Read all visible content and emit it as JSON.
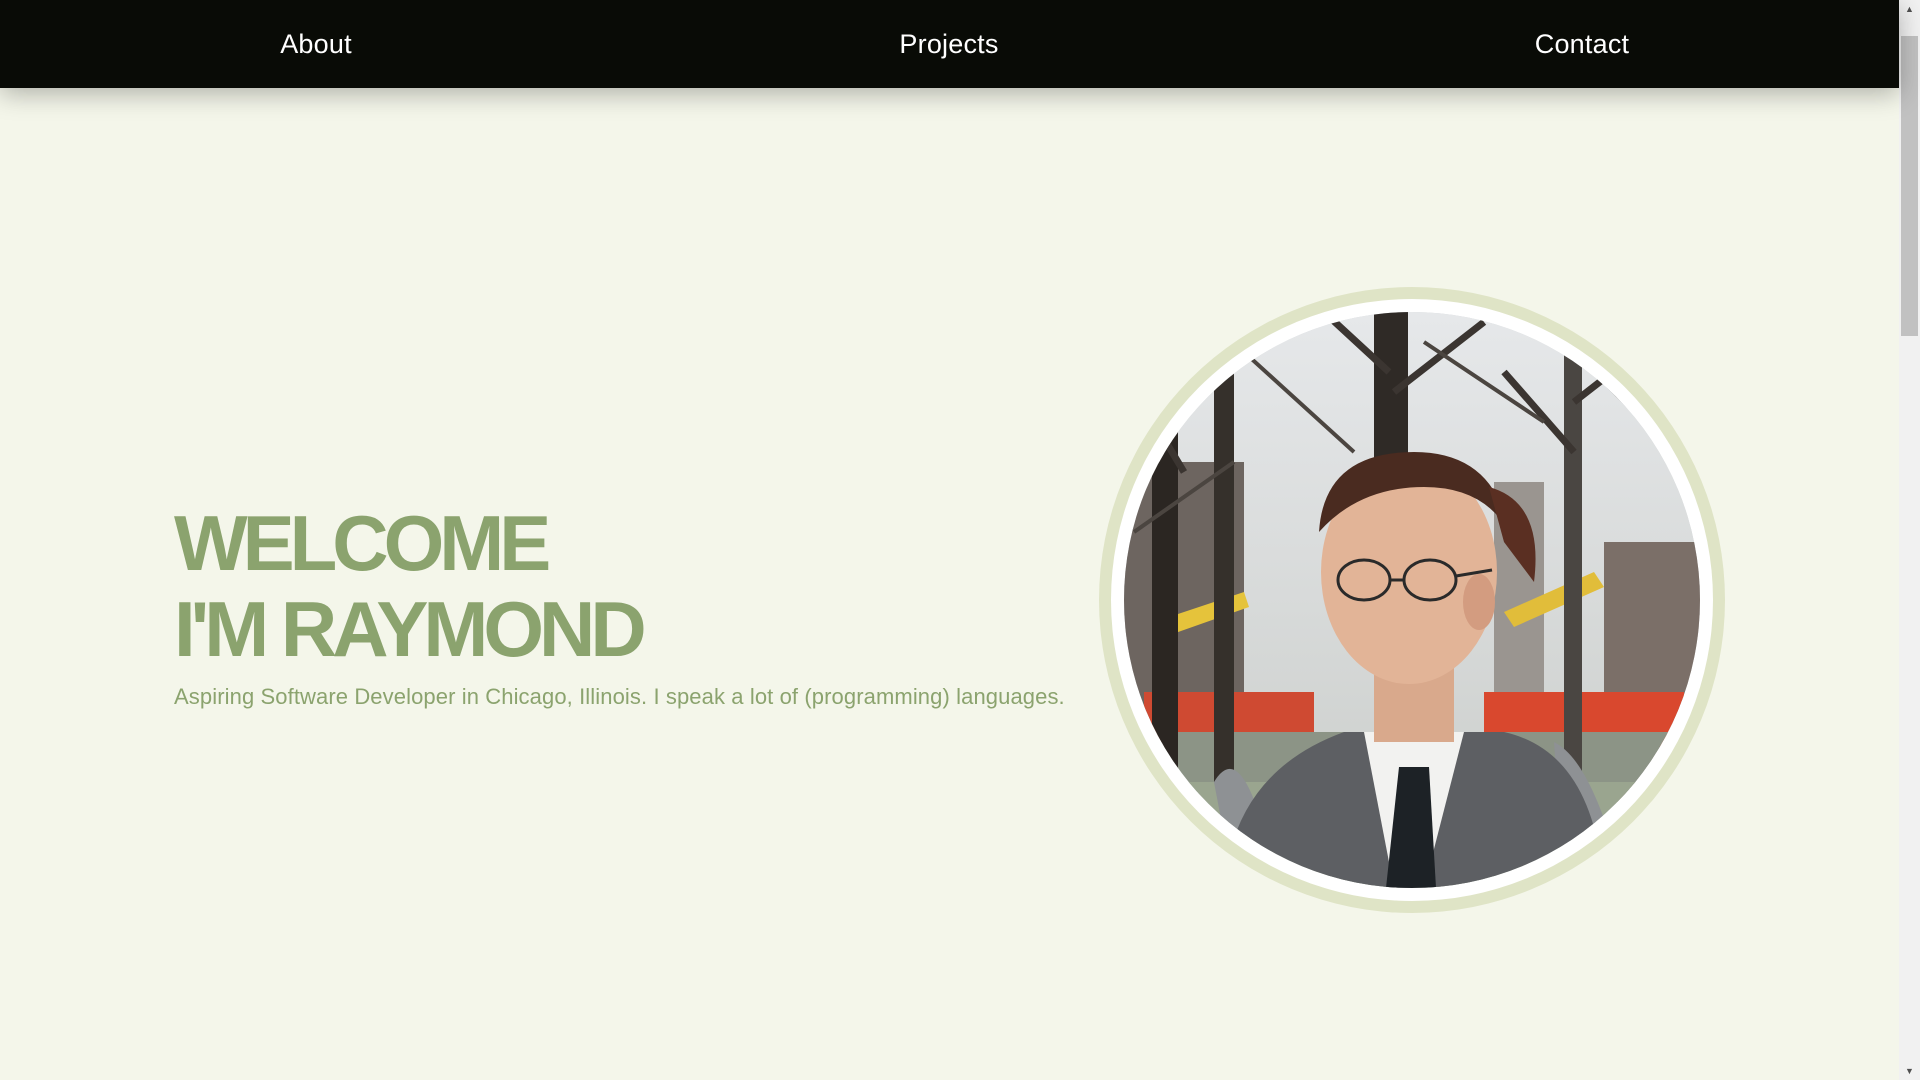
{
  "nav": {
    "about": "About",
    "projects": "Projects",
    "contact": "Contact"
  },
  "hero": {
    "line1": "WELCOME",
    "line2": "I'M RAYMOND",
    "subtitle": "Aspiring Software Developer in Chicago, Illinois. I speak a lot of (programming) languages."
  },
  "colors": {
    "nav_background": "#090b06",
    "page_background": "#f4f6ea",
    "accent_green": "#8ba36e",
    "ring": "#dfe4c6"
  },
  "icons": {
    "scroll_up": "▲",
    "scroll_down": "▼"
  }
}
